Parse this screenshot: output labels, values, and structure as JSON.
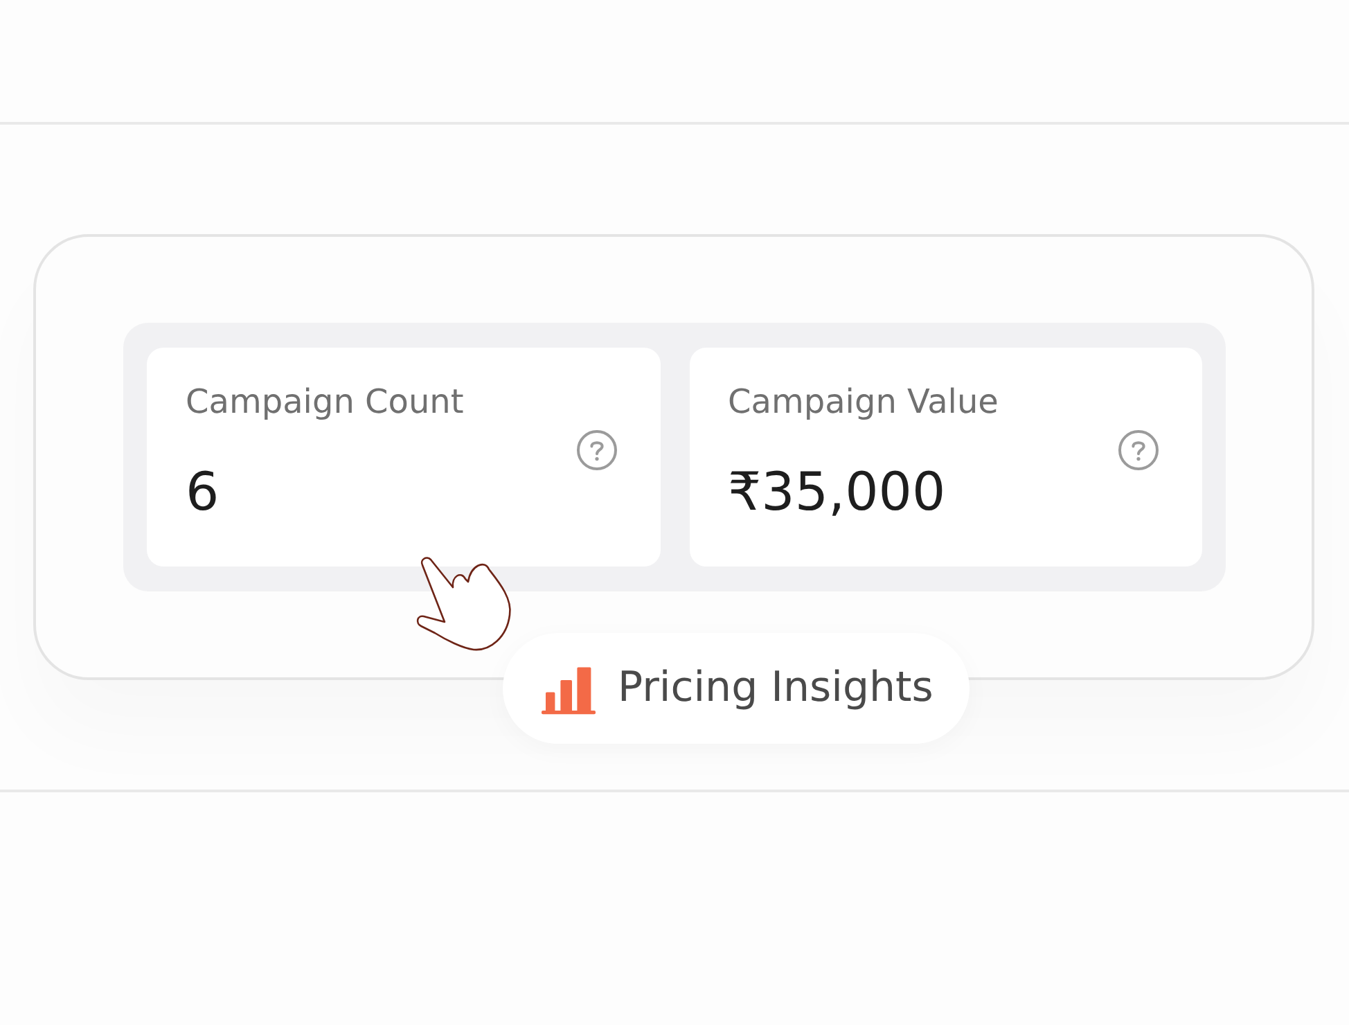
{
  "metrics": [
    {
      "label": "Campaign Count",
      "value": "6"
    },
    {
      "label": "Campaign Value",
      "value": "₹35,000"
    }
  ],
  "insights_chip": {
    "label": "Pricing Insights"
  }
}
